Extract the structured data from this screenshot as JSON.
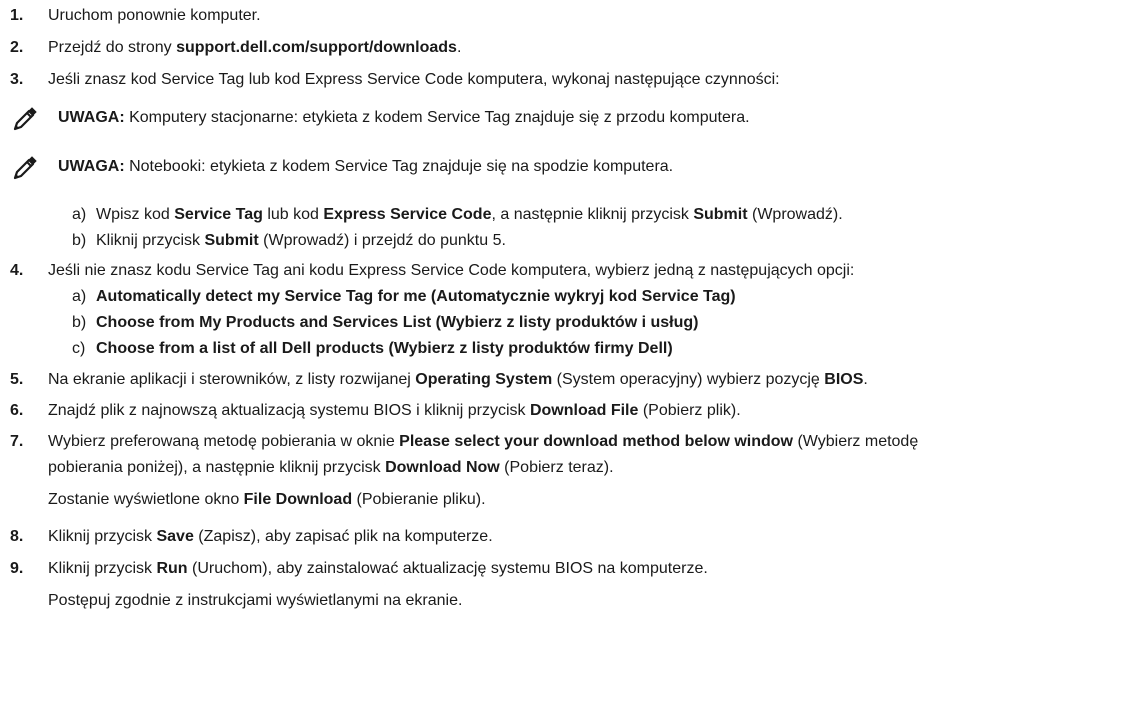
{
  "steps": {
    "s1": {
      "num": "1.",
      "t1": "Uruchom ponownie komputer."
    },
    "s2": {
      "num": "2.",
      "t1": "Przejdź do strony ",
      "b1": "support.dell.com/support/downloads",
      "t2": "."
    },
    "s3": {
      "num": "3.",
      "t1": "Jeśli znasz kod Service Tag lub kod Express Service Code komputera, wykonaj następujące czynności:"
    },
    "note1": {
      "label": "UWAGA:",
      "text": " Komputery stacjonarne: etykieta z kodem Service Tag znajduje się z przodu komputera.",
      "icon": "pencil-note-icon"
    },
    "note2": {
      "label": "UWAGA:",
      "text": " Notebooki: etykieta z kodem Service Tag znajduje się na spodzie komputera.",
      "icon": "pencil-note-icon"
    },
    "s3a": {
      "letter": "a)",
      "t1": "Wpisz kod ",
      "b1": "Service Tag",
      "t2": " lub kod ",
      "b2": "Express Service Code",
      "t3": ", a następnie kliknij przycisk ",
      "b3": "Submit",
      "t4": " (Wprowadź)."
    },
    "s3b": {
      "letter": "b)",
      "t1": "Kliknij przycisk ",
      "b1": "Submit",
      "t2": " (Wprowadź) i przejdź do punktu 5."
    },
    "s4": {
      "num": "4.",
      "t1": "Jeśli nie znasz kodu Service Tag ani kodu Express Service Code komputera, wybierz jedną z następujących opcji:"
    },
    "s4a": {
      "letter": "a)",
      "b1": "Automatically detect my Service Tag for me (Automatycznie wykryj kod Service Tag)"
    },
    "s4b": {
      "letter": "b)",
      "b1": "Choose from My Products and Services List (Wybierz z listy produktów i usług)"
    },
    "s4c": {
      "letter": "c)",
      "b1": "Choose from a list of all Dell products (Wybierz z listy produktów firmy Dell)"
    },
    "s5": {
      "num": "5.",
      "t1": "Na ekranie aplikacji i sterowników, z listy rozwijanej ",
      "b1": "Operating System",
      "t2": " (System operacyjny) wybierz pozycję ",
      "b2": "BIOS",
      "t3": "."
    },
    "s6": {
      "num": "6.",
      "t1": "Znajdź plik z najnowszą aktualizacją systemu BIOS i kliknij przycisk ",
      "b1": "Download File",
      "t2": " (Pobierz plik)."
    },
    "s7": {
      "num": "7.",
      "t1": "Wybierz preferowaną metodę pobierania w oknie ",
      "b1": "Please select your download method below window",
      "t2": " (Wybierz metodę"
    },
    "s7c1": {
      "t1": "pobierania poniżej), a następnie kliknij przycisk ",
      "b1": "Download Now",
      "t2": " (Pobierz teraz)."
    },
    "s7c2": {
      "t1": "Zostanie wyświetlone okno ",
      "b1": "File Download",
      "t2": " (Pobieranie pliku)."
    },
    "s8": {
      "num": "8.",
      "t1": "Kliknij przycisk ",
      "b1": "Save",
      "t2": " (Zapisz), aby zapisać plik na komputerze."
    },
    "s9": {
      "num": "9.",
      "t1": "Kliknij przycisk ",
      "b1": "Run",
      "t2": " (Uruchom), aby zainstalować aktualizację systemu BIOS na komputerze."
    },
    "s9c1": {
      "t1": "Postępuj zgodnie z instrukcjami wyświetlanymi na ekranie."
    }
  }
}
